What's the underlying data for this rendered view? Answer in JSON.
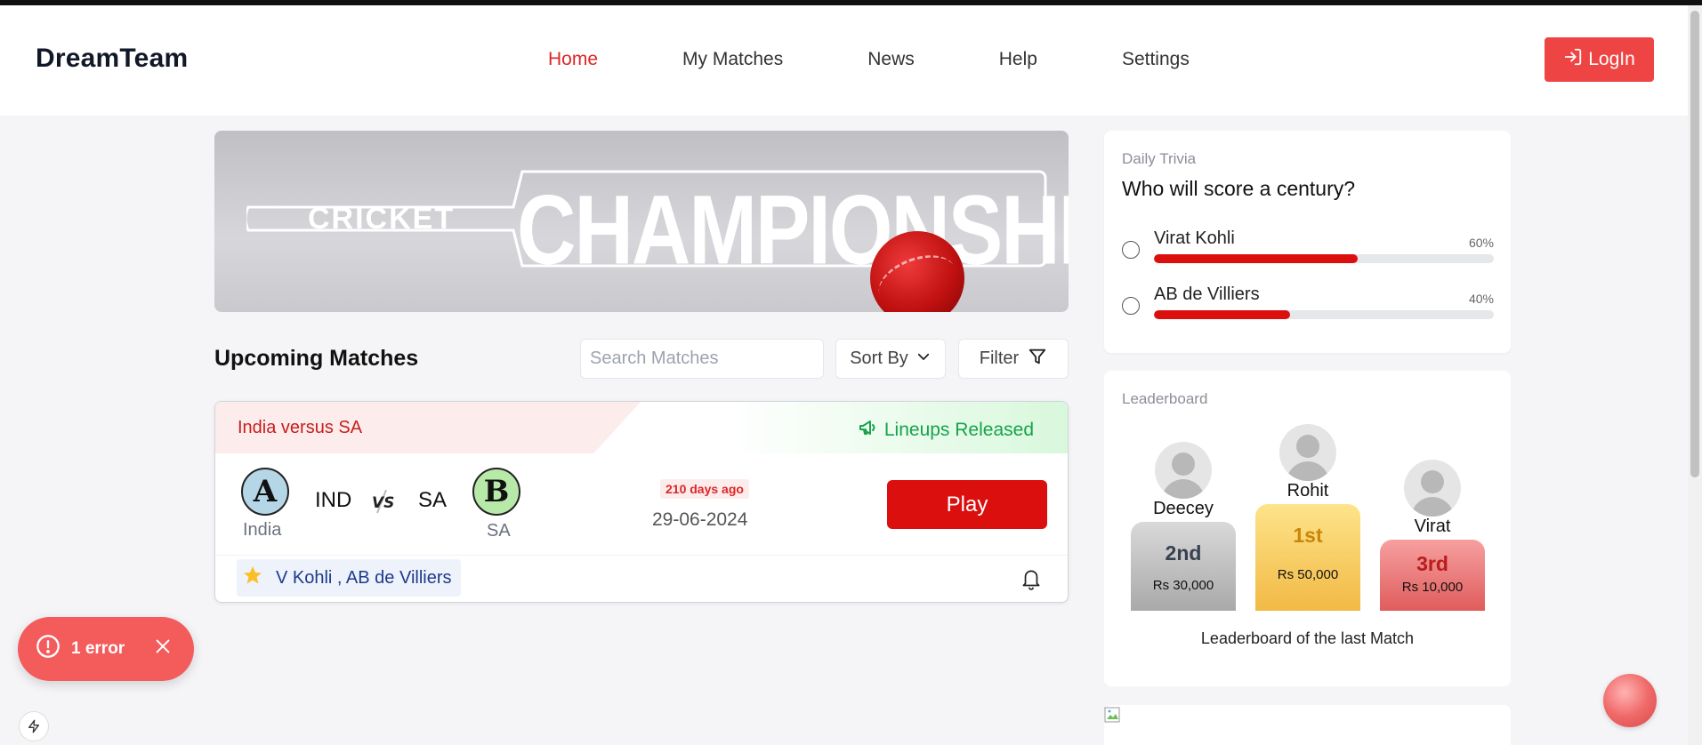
{
  "header": {
    "brand": "DreamTeam",
    "nav": [
      {
        "label": "Home",
        "active": true
      },
      {
        "label": "My Matches",
        "active": false
      },
      {
        "label": "News",
        "active": false
      },
      {
        "label": "Help",
        "active": false
      },
      {
        "label": "Settings",
        "active": false
      }
    ],
    "login_label": "LogIn"
  },
  "banner": {
    "small_text": "CRICKET",
    "big_text": "CHAMPIONSHIP"
  },
  "upcoming": {
    "title": "Upcoming Matches",
    "search_placeholder": "Search Matches",
    "sort_label": "Sort By",
    "filter_label": "Filter"
  },
  "match": {
    "title": "India versus SA",
    "status": "Lineups Released",
    "team_a": {
      "letter": "A",
      "abbr": "IND",
      "name": "India"
    },
    "team_b": {
      "letter": "B",
      "abbr": "SA",
      "name": "SA"
    },
    "vs": "VS",
    "ago": "210 days ago",
    "date": "29-06-2024",
    "play_label": "Play",
    "players": "V Kohli , AB de Villiers"
  },
  "trivia": {
    "label": "Daily Trivia",
    "question": "Who will score a century?",
    "options": [
      {
        "name": "Virat Kohli",
        "pct_label": "60%",
        "pct": 60
      },
      {
        "name": "AB de Villiers",
        "pct_label": "40%",
        "pct": 40
      }
    ]
  },
  "leaderboard": {
    "label": "Leaderboard",
    "first": {
      "name": "Rohit",
      "rank": "1st",
      "amount": "Rs 50,000"
    },
    "second": {
      "name": "Deecey",
      "rank": "2nd",
      "amount": "Rs 30,000"
    },
    "third": {
      "name": "Virat",
      "rank": "3rd",
      "amount": "Rs 10,000"
    },
    "caption": "Leaderboard of the last Match"
  },
  "error_toast": {
    "label": "1 error"
  },
  "colors": {
    "accent": "#dc2626",
    "play": "#dc0f0f",
    "success": "#16a34a",
    "error_toast": "#f45b5b"
  }
}
